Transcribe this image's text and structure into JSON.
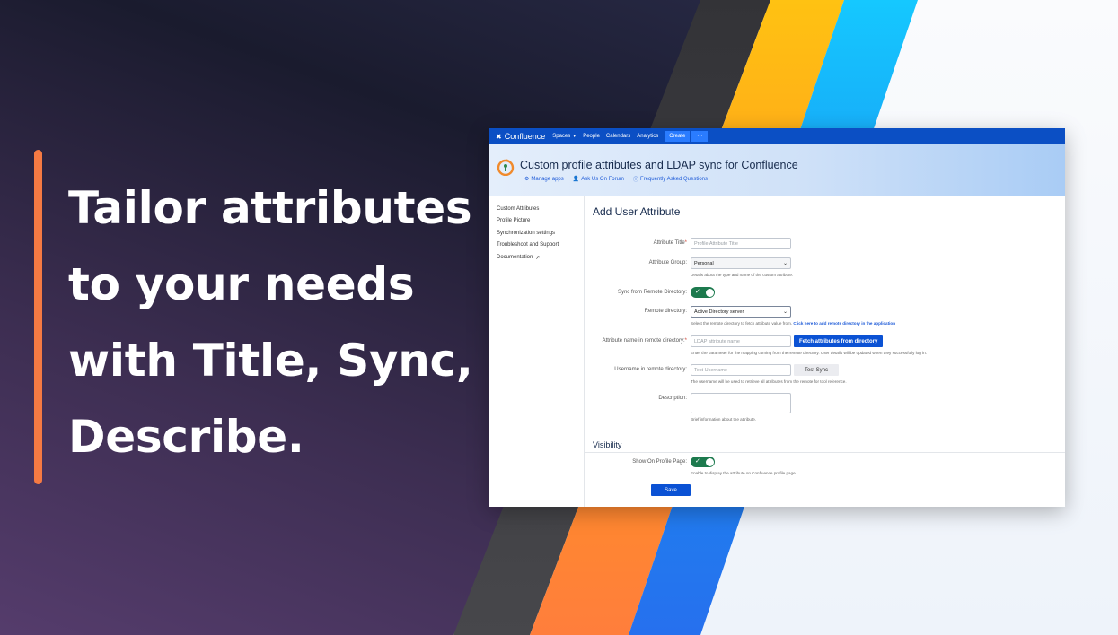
{
  "headline": [
    "Tailor attributes",
    "to your needs",
    "with Title, Sync,",
    "Describe."
  ],
  "colors": {
    "accent_bar": "#f57a43",
    "nav_bg": "#0b4fc4",
    "primary": "#0b52d4",
    "toggle_on": "#1d7a4e"
  },
  "topnav": {
    "brand": "Confluence",
    "items": [
      "Spaces",
      "People",
      "Calendars",
      "Analytics"
    ],
    "create": "Create",
    "more": "···"
  },
  "banner": {
    "title": "Custom profile attributes and LDAP sync for Confluence",
    "links": [
      {
        "icon": "gear-icon",
        "label": "Manage apps"
      },
      {
        "icon": "person-icon",
        "label": "Ask Us On Forum"
      },
      {
        "icon": "question-icon",
        "label": "Frequently Asked Questions"
      }
    ]
  },
  "sidebar": {
    "items": [
      "Custom Attributes",
      "Profile Picture",
      "Synchronization settings",
      "Troubleshoot and Support",
      "Documentation"
    ]
  },
  "form": {
    "title": "Add User Attribute",
    "attribute_title": {
      "label": "Attribute Title",
      "placeholder": "Profile Attribute Title"
    },
    "attribute_group": {
      "label": "Attribute Group:",
      "value": "Personal",
      "help": "Details about the type and name of the custom attribute."
    },
    "sync_remote": {
      "label": "Sync from Remote Directory:",
      "on": true
    },
    "remote_directory": {
      "label": "Remote directory:",
      "value": "Active Directory server",
      "help": "Select the remote directory to fetch attribute value from.",
      "help_link": "Click here to add remote directory in the application"
    },
    "attr_name_remote": {
      "label": "Attribute name in remote directory:",
      "placeholder": "LDAP attribute name",
      "button": "Fetch attributes from directory",
      "help": "Enter the parameter for the mapping coming from the remote directory. User details will be updated when they successfully log in."
    },
    "username_remote": {
      "label": "Username in remote directory:",
      "placeholder": "Test Username",
      "button": "Test Sync",
      "help": "The username will be used to retrieve all attributes from the remote for tool reference."
    },
    "description": {
      "label": "Description:",
      "help": "Brief information about the attribute."
    },
    "visibility": {
      "title": "Visibility",
      "show_on_profile": {
        "label": "Show On Profile Page:",
        "on": true,
        "help": "Enable to display the attribute on Confluence profile page."
      }
    },
    "save": "Save"
  }
}
